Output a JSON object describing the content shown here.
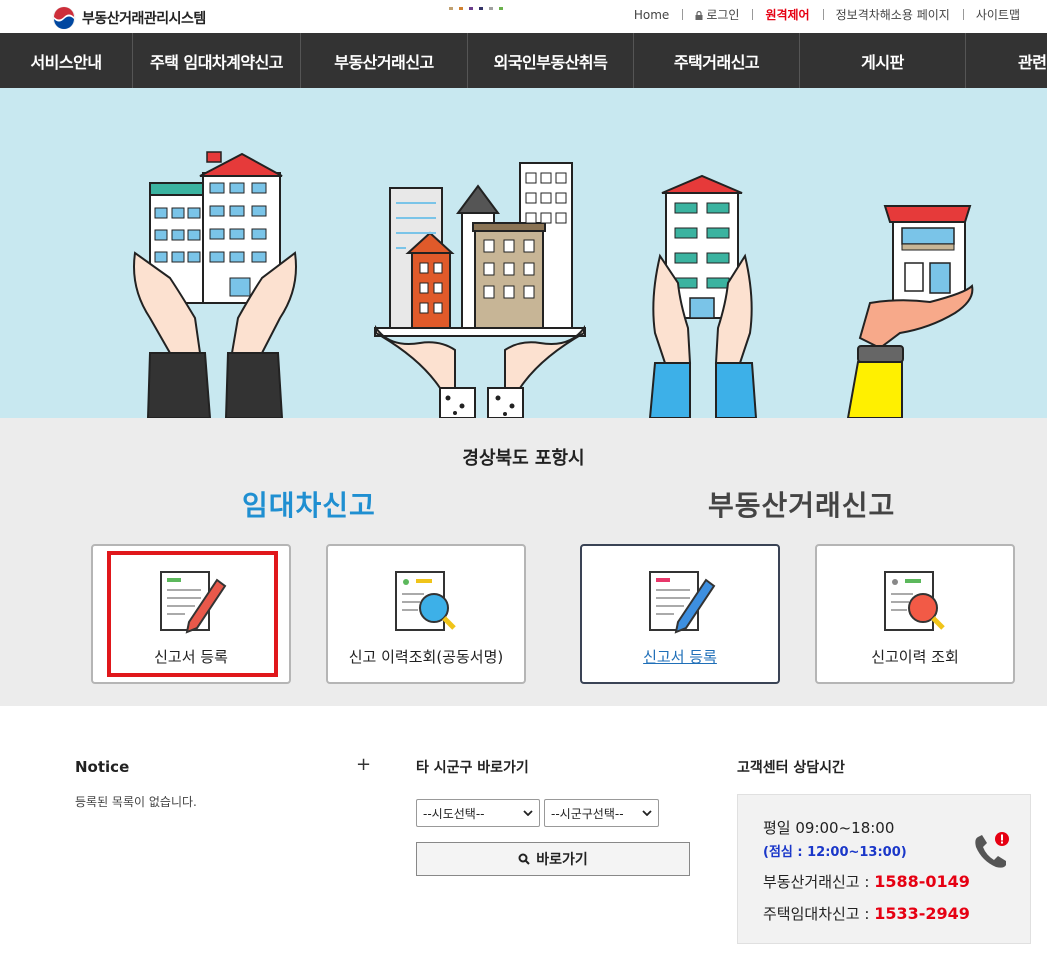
{
  "header": {
    "logo_text": "부동산거래관리시스템",
    "util_links": [
      {
        "label": "Home"
      },
      {
        "label": "로그인"
      },
      {
        "label": "원격제어"
      },
      {
        "label": "정보격차해소용 페이지"
      },
      {
        "label": "사이트맵"
      }
    ],
    "dot_colors": [
      "#c0a070",
      "#d08030",
      "#6a3c8a",
      "#333366",
      "#a0a0a0",
      "#6ab04c"
    ]
  },
  "nav": {
    "items": [
      {
        "label": "서비스안내"
      },
      {
        "label": "주택 임대차계약신고"
      },
      {
        "label": "부동산거래신고"
      },
      {
        "label": "외국인부동산취득"
      },
      {
        "label": "주택거래신고"
      },
      {
        "label": "게시판"
      },
      {
        "label": "관련"
      }
    ]
  },
  "region": "경상북도 포항시",
  "lease_section": {
    "title": "임대차신고",
    "cards": [
      {
        "label": "신고서 등록"
      },
      {
        "label": "신고 이력조회(공동서명)"
      }
    ]
  },
  "trade_section": {
    "title": "부동산거래신고",
    "cards": [
      {
        "label": "신고서 등록"
      },
      {
        "label": "신고이력 조회"
      }
    ]
  },
  "notice": {
    "title": "Notice",
    "plus": "+",
    "empty_text": "등록된 목록이 없습니다."
  },
  "jump": {
    "title": "타 시군구 바로가기",
    "sido_select": "--시도선택--",
    "sigungu_select": "--시군구선택--",
    "go_button": "바로가기"
  },
  "customer_center": {
    "title": "고객센터 상담시간",
    "weekday": "평일 09:00~18:00",
    "lunch": "(점심 : 12:00~13:00)",
    "trade_label": "부동산거래신고 : ",
    "trade_number": "1588-0149",
    "lease_label": "주택임대차신고 : ",
    "lease_number": "1533-2949"
  },
  "colors": {
    "accent_blue": "#1f8fd1",
    "highlight_red": "#e0171b",
    "phone_red": "#e60012",
    "nav_bg": "#333333",
    "hero_bg": "#c8e8f0"
  }
}
